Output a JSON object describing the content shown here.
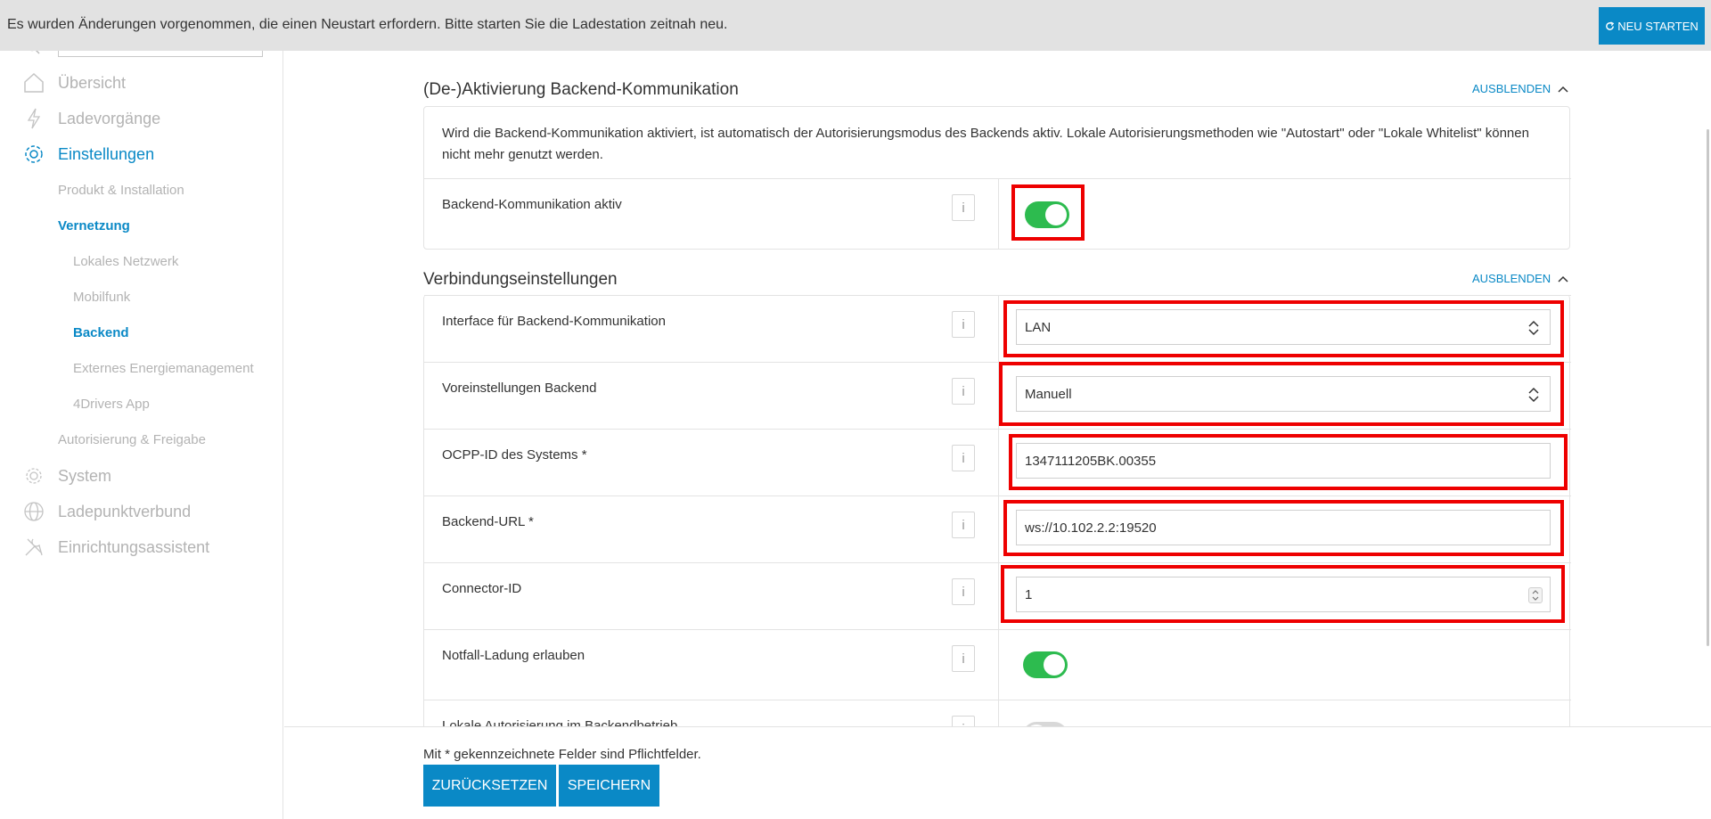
{
  "banner": {
    "text": "Es wurden Änderungen vorgenommen, die einen Neustart erfordern. Bitte starten Sie die Ladestation zeitnah neu.",
    "restart_label": "NEU STARTEN"
  },
  "sidebar": {
    "items": [
      {
        "label": "Übersicht",
        "icon": "home-icon"
      },
      {
        "label": "Ladevorgänge",
        "icon": "lightning-icon"
      },
      {
        "label": "Einstellungen",
        "icon": "gear-icon",
        "active": true
      },
      {
        "label": "System",
        "icon": "system-icon"
      },
      {
        "label": "Ladepunktverbund",
        "icon": "globe-icon"
      },
      {
        "label": "Einrichtungsassistent",
        "icon": "wrench-icon"
      }
    ],
    "sub_items": [
      {
        "label": "Produkt & Installation"
      },
      {
        "label": "Vernetzung",
        "active": true
      },
      {
        "label": "Lokales Netzwerk"
      },
      {
        "label": "Mobilfunk"
      },
      {
        "label": "Backend",
        "active": true
      },
      {
        "label": "Externes Energiemanagement"
      },
      {
        "label": "4Drivers App"
      },
      {
        "label": "Autorisierung & Freigabe"
      }
    ]
  },
  "section1": {
    "title": "(De-)Aktivierung Backend-Kommunikation",
    "hide_label": "AUSBLENDEN",
    "info_text": "Wird die Backend-Kommunikation aktiviert, ist automatisch der Autorisierungsmodus des Backends aktiv. Lokale Autorisierungsmethoden wie \"Autostart\" oder \"Lokale Whitelist\" können nicht mehr genutzt werden.",
    "row_label": "Backend-Kommunikation aktiv",
    "toggle_on": true
  },
  "section2": {
    "title": "Verbindungseinstellungen",
    "hide_label": "AUSBLENDEN",
    "rows": [
      {
        "label": "Interface für Backend-Kommunikation",
        "value": "LAN"
      },
      {
        "label": "Voreinstellungen Backend",
        "value": "Manuell"
      },
      {
        "label": "OCPP-ID des Systems *",
        "value": "1347111205BK.00355"
      },
      {
        "label": "Backend-URL *",
        "value": "ws://10.102.2.2:19520"
      },
      {
        "label": "Connector-ID",
        "value": "1"
      },
      {
        "label": "Notfall-Ladung erlauben",
        "toggle_on": true
      },
      {
        "label": "Lokale Autorisierung im Backendbetrieb",
        "toggle_on": false
      }
    ]
  },
  "info_glyph": "i",
  "footer": {
    "required_note": "Mit * gekennzeichnete Felder sind Pflichtfelder.",
    "reset_label": "ZURÜCKSETZEN",
    "save_label": "SPEICHERN"
  },
  "colors": {
    "accent": "#0a89c6",
    "toggle_on": "#2dbb4f",
    "highlight": "#ee0000"
  }
}
